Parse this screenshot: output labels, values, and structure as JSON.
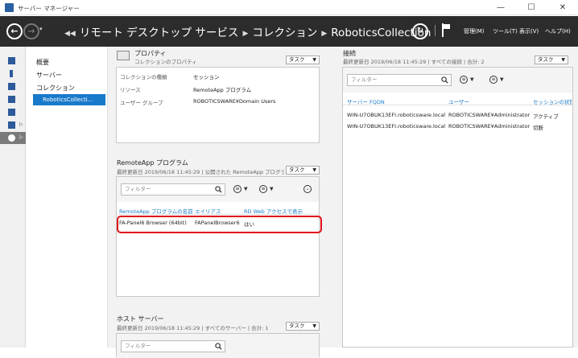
{
  "window": {
    "title": "サーバー マネージャー"
  },
  "nav": {
    "dropdown_glyph": "▾",
    "breadcrumb": [
      "リモート デスクトップ サービス",
      "コレクション",
      "RoboticsCollection"
    ],
    "menus": [
      "管理(M)",
      "ツール(T)",
      "表示(V)",
      "ヘルプ(H)"
    ]
  },
  "leftnav": {
    "items": [
      "概要",
      "サーバー",
      "コレクション"
    ],
    "selected": "RoboticsCollecti..."
  },
  "properties": {
    "title": "プロパティ",
    "subtitle": "コレクションのプロパティ",
    "task_label": "タスク",
    "rows": [
      {
        "label": "コレクションの種類",
        "value": "セッション"
      },
      {
        "label": "リソース",
        "value": "RemoteApp プログラム"
      },
      {
        "label": "ユーザー グループ",
        "value": "ROBOTICSWARE¥Domain Users"
      }
    ]
  },
  "remoteapp": {
    "title": "RemoteApp プログラム",
    "subtitle": "最終更新日 2019/06/18 11:45:29 | 公開された RemoteApp プログラ...",
    "task_label": "タスク",
    "filter_placeholder": "フィルター",
    "columns": [
      "RemoteApp プログラムの名前",
      "エイリアス",
      "RD Web アクセスで表示"
    ],
    "rows": [
      [
        "FA-Panel6 Browser (64bit)",
        "FAPanelBrowser6",
        "はい"
      ]
    ]
  },
  "hosts": {
    "title": "ホスト サーバー",
    "subtitle": "最終更新日 2019/06/18 11:45:29 | すべてのサーバー | 合計: 1",
    "task_label": "タスク",
    "filter_placeholder": "フィルター"
  },
  "connections": {
    "title": "接続",
    "subtitle": "最終更新日 2019/06/18 11:45:29 | すべての接続 | 合計: 2",
    "task_label": "タスク",
    "filter_placeholder": "フィルター",
    "columns": [
      "サーバー FQDN",
      "ユーザー",
      "セッションの状態"
    ],
    "rows": [
      [
        "WIN-U7OBUK13EFI.roboticsware.local",
        "ROBOTICSWARE¥Administrator",
        "アクティブ"
      ],
      [
        "WIN-U7OBUK13EFI.roboticsware.local",
        "ROBOTICSWARE¥Administrator",
        "切断"
      ]
    ]
  }
}
